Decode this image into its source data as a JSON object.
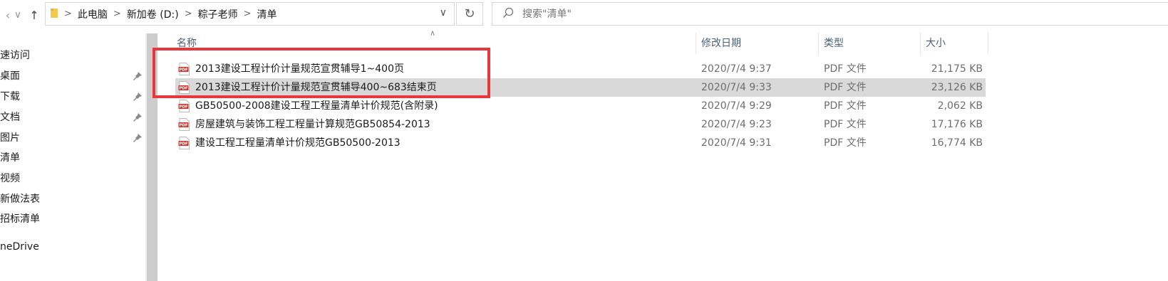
{
  "toolbar": {
    "breadcrumbs": [
      "此电脑",
      "新加卷 (D:)",
      "粽子老师",
      "清单"
    ],
    "search_placeholder": "搜索\"清单\""
  },
  "sidebar": {
    "items": [
      {
        "label": "速访问",
        "pinned": false
      },
      {
        "label": "桌面",
        "pinned": true
      },
      {
        "label": "下载",
        "pinned": true
      },
      {
        "label": "文档",
        "pinned": true
      },
      {
        "label": "图片",
        "pinned": true
      },
      {
        "label": "清单",
        "pinned": false
      },
      {
        "label": "视频",
        "pinned": false
      },
      {
        "label": "新做法表",
        "pinned": false
      },
      {
        "label": "招标清单",
        "pinned": false
      },
      {
        "label": "neDrive",
        "pinned": false
      }
    ]
  },
  "columns": {
    "name": "名称",
    "date": "修改日期",
    "type": "类型",
    "size": "大小"
  },
  "files": [
    {
      "name": "2013建设工程计价计量规范宣贯辅导1~400页",
      "date": "2020/7/4 9:37",
      "type": "PDF 文件",
      "size": "21,175 KB",
      "selected": false
    },
    {
      "name": "2013建设工程计价计量规范宣贯辅导400~683结束页",
      "date": "2020/7/4 9:33",
      "type": "PDF 文件",
      "size": "23,126 KB",
      "selected": true
    },
    {
      "name": "GB50500-2008建设工程工程量清单计价规范(含附录)",
      "date": "2020/7/4 9:29",
      "type": "PDF 文件",
      "size": "2,062 KB",
      "selected": false
    },
    {
      "name": "房屋建筑与装饰工程工程量计算规范GB50854-2013",
      "date": "2020/7/4 9:23",
      "type": "PDF 文件",
      "size": "17,176 KB",
      "selected": false
    },
    {
      "name": "建设工程工程量清单计价规范GB50500-2013",
      "date": "2020/7/4 9:31",
      "type": "PDF 文件",
      "size": "16,774 KB",
      "selected": false
    }
  ],
  "icons": {
    "pdf_badge": "PDF",
    "accent_red": "#e8383d",
    "folder_yellow": "#f4c94c"
  }
}
